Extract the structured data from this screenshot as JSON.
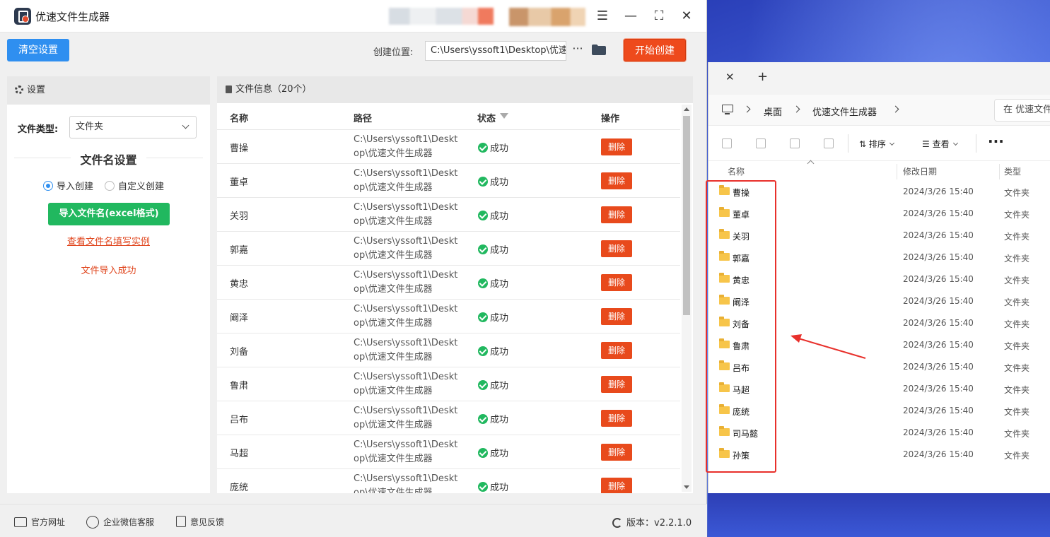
{
  "app": {
    "title": "优速文件生成器",
    "window_controls": {
      "menu": "☰",
      "minimize": "—",
      "maximize": "⛶",
      "close": "✕"
    }
  },
  "toolbar": {
    "clear_label": "清空设置",
    "location_label": "创建位置:",
    "location_value": "C:\\Users\\yssoft1\\Desktop\\优速",
    "more_label": "···",
    "start_label": "开始创建"
  },
  "settings": {
    "header": "设置",
    "file_type_label": "文件类型:",
    "file_type_value": "文件夹",
    "section_title": "文件名设置",
    "radio_import": "导入创建",
    "radio_custom": "自定义创建",
    "import_button": "导入文件名(excel格式)",
    "example_link": "查看文件名填写实例",
    "import_status": "文件导入成功"
  },
  "fileinfo": {
    "header": "文件信息（20个）",
    "columns": {
      "name": "名称",
      "path": "路径",
      "status": "状态",
      "op": "操作"
    },
    "rows": [
      {
        "name": "曹操",
        "path": "C:\\Users\\yssoft1\\Desktop\\优速文件生成器",
        "status": "成功",
        "op": "删除"
      },
      {
        "name": "董卓",
        "path": "C:\\Users\\yssoft1\\Desktop\\优速文件生成器",
        "status": "成功",
        "op": "删除"
      },
      {
        "name": "关羽",
        "path": "C:\\Users\\yssoft1\\Desktop\\优速文件生成器",
        "status": "成功",
        "op": "删除"
      },
      {
        "name": "郭嘉",
        "path": "C:\\Users\\yssoft1\\Desktop\\优速文件生成器",
        "status": "成功",
        "op": "删除"
      },
      {
        "name": "黄忠",
        "path": "C:\\Users\\yssoft1\\Desktop\\优速文件生成器",
        "status": "成功",
        "op": "删除"
      },
      {
        "name": "阚泽",
        "path": "C:\\Users\\yssoft1\\Desktop\\优速文件生成器",
        "status": "成功",
        "op": "删除"
      },
      {
        "name": "刘备",
        "path": "C:\\Users\\yssoft1\\Desktop\\优速文件生成器",
        "status": "成功",
        "op": "删除"
      },
      {
        "name": "鲁肃",
        "path": "C:\\Users\\yssoft1\\Desktop\\优速文件生成器",
        "status": "成功",
        "op": "删除"
      },
      {
        "name": "吕布",
        "path": "C:\\Users\\yssoft1\\Desktop\\优速文件生成器",
        "status": "成功",
        "op": "删除"
      },
      {
        "name": "马超",
        "path": "C:\\Users\\yssoft1\\Desktop\\优速文件生成器",
        "status": "成功",
        "op": "删除"
      },
      {
        "name": "庞统",
        "path": "C:\\Users\\yssoft1\\Desktop\\优速文件生成器",
        "status": "成功",
        "op": "删除"
      }
    ]
  },
  "footer": {
    "website": "官方网址",
    "wechat": "企业微信客服",
    "feedback": "意见反馈",
    "version": "版本：v2.2.1.0"
  },
  "explorer": {
    "breadcrumb": [
      "桌面",
      "优速文件生成器"
    ],
    "search_placeholder": "在 优速文件",
    "sort_label": "排序",
    "view_label": "查看",
    "more_label": "···",
    "columns": {
      "name": "名称",
      "date": "修改日期",
      "type": "类型"
    },
    "rows": [
      {
        "name": "曹操",
        "date": "2024/3/26 15:40",
        "type": "文件夹"
      },
      {
        "name": "董卓",
        "date": "2024/3/26 15:40",
        "type": "文件夹"
      },
      {
        "name": "关羽",
        "date": "2024/3/26 15:40",
        "type": "文件夹"
      },
      {
        "name": "郭嘉",
        "date": "2024/3/26 15:40",
        "type": "文件夹"
      },
      {
        "name": "黄忠",
        "date": "2024/3/26 15:40",
        "type": "文件夹"
      },
      {
        "name": "阚泽",
        "date": "2024/3/26 15:40",
        "type": "文件夹"
      },
      {
        "name": "刘备",
        "date": "2024/3/26 15:40",
        "type": "文件夹"
      },
      {
        "name": "鲁肃",
        "date": "2024/3/26 15:40",
        "type": "文件夹"
      },
      {
        "name": "吕布",
        "date": "2024/3/26 15:40",
        "type": "文件夹"
      },
      {
        "name": "马超",
        "date": "2024/3/26 15:40",
        "type": "文件夹"
      },
      {
        "name": "庞统",
        "date": "2024/3/26 15:40",
        "type": "文件夹"
      },
      {
        "name": "司马懿",
        "date": "2024/3/26 15:40",
        "type": "文件夹"
      },
      {
        "name": "孙策",
        "date": "2024/3/26 15:40",
        "type": "文件夹"
      }
    ]
  },
  "colors": {
    "primary_blue": "#2f8ff0",
    "start_red": "#ee4a1c",
    "success_green": "#21b85f",
    "highlight_red": "#e8302b"
  }
}
